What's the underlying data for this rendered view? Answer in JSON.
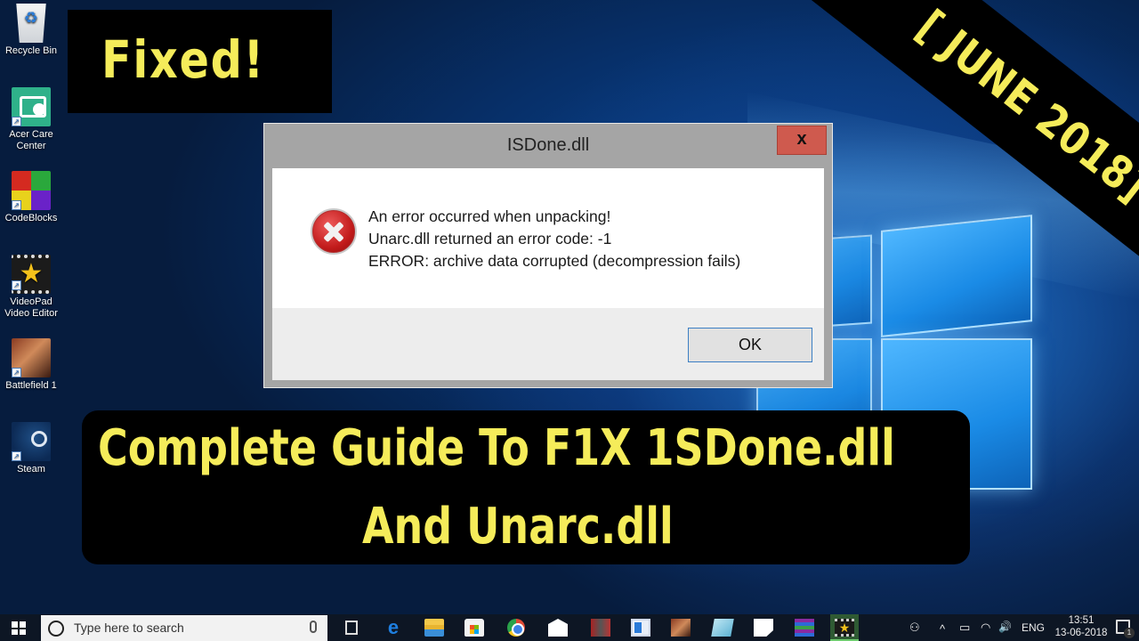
{
  "desktop": {
    "icons": [
      {
        "label": "Recycle Bin",
        "icon": "recycle-bin-icon",
        "shortcut": false
      },
      {
        "label": "Acer Care Center",
        "icon": "acer-care-center-icon",
        "shortcut": true
      },
      {
        "label": "CodeBlocks",
        "icon": "codeblocks-icon",
        "shortcut": true
      },
      {
        "label": "VideoPad Video Editor",
        "icon": "videopad-icon",
        "shortcut": true
      },
      {
        "label": "Battlefield 1",
        "icon": "battlefield-icon",
        "shortcut": true
      },
      {
        "label": "Steam",
        "icon": "steam-icon",
        "shortcut": true
      }
    ],
    "shortcut_glyph": "↗"
  },
  "overlays": {
    "fixed_label": "Fixed!",
    "ribbon_label": "[ JUNE 2018]",
    "banner_line1": "Complete Guide To F1X 1SDone.dll",
    "banner_line2": "And Unarc.dll",
    "text_color": "#f5ec5a"
  },
  "dialog": {
    "title": "ISDone.dll",
    "close_label": "x",
    "icon": "error-icon",
    "messages": [
      "An error occurred when unpacking!",
      "Unarc.dll returned an error code: -1",
      "ERROR: archive data corrupted (decompression fails)"
    ],
    "ok_label": "OK"
  },
  "taskbar": {
    "search_placeholder": "Type here to search",
    "apps": [
      {
        "name": "task-view",
        "glyph": ""
      },
      {
        "name": "edge",
        "glyph": "e"
      },
      {
        "name": "file-explorer",
        "glyph": ""
      },
      {
        "name": "store",
        "glyph": ""
      },
      {
        "name": "chrome",
        "glyph": ""
      },
      {
        "name": "mail",
        "glyph": ""
      },
      {
        "name": "media-app",
        "glyph": ""
      },
      {
        "name": "window-app",
        "glyph": ""
      },
      {
        "name": "battlefield",
        "glyph": ""
      },
      {
        "name": "notepad",
        "glyph": ""
      },
      {
        "name": "sticky-notes",
        "glyph": ""
      },
      {
        "name": "winrar",
        "glyph": ""
      },
      {
        "name": "videopad",
        "glyph": "★",
        "active": true
      }
    ],
    "tray": {
      "people_glyph": "⚇",
      "chevron_glyph": "^",
      "battery_glyph": "▭",
      "wifi_glyph": "◠",
      "volume_glyph": "🔊",
      "language": "ENG",
      "time": "13:51",
      "date": "13-06-2018",
      "notification_count": "1"
    }
  }
}
